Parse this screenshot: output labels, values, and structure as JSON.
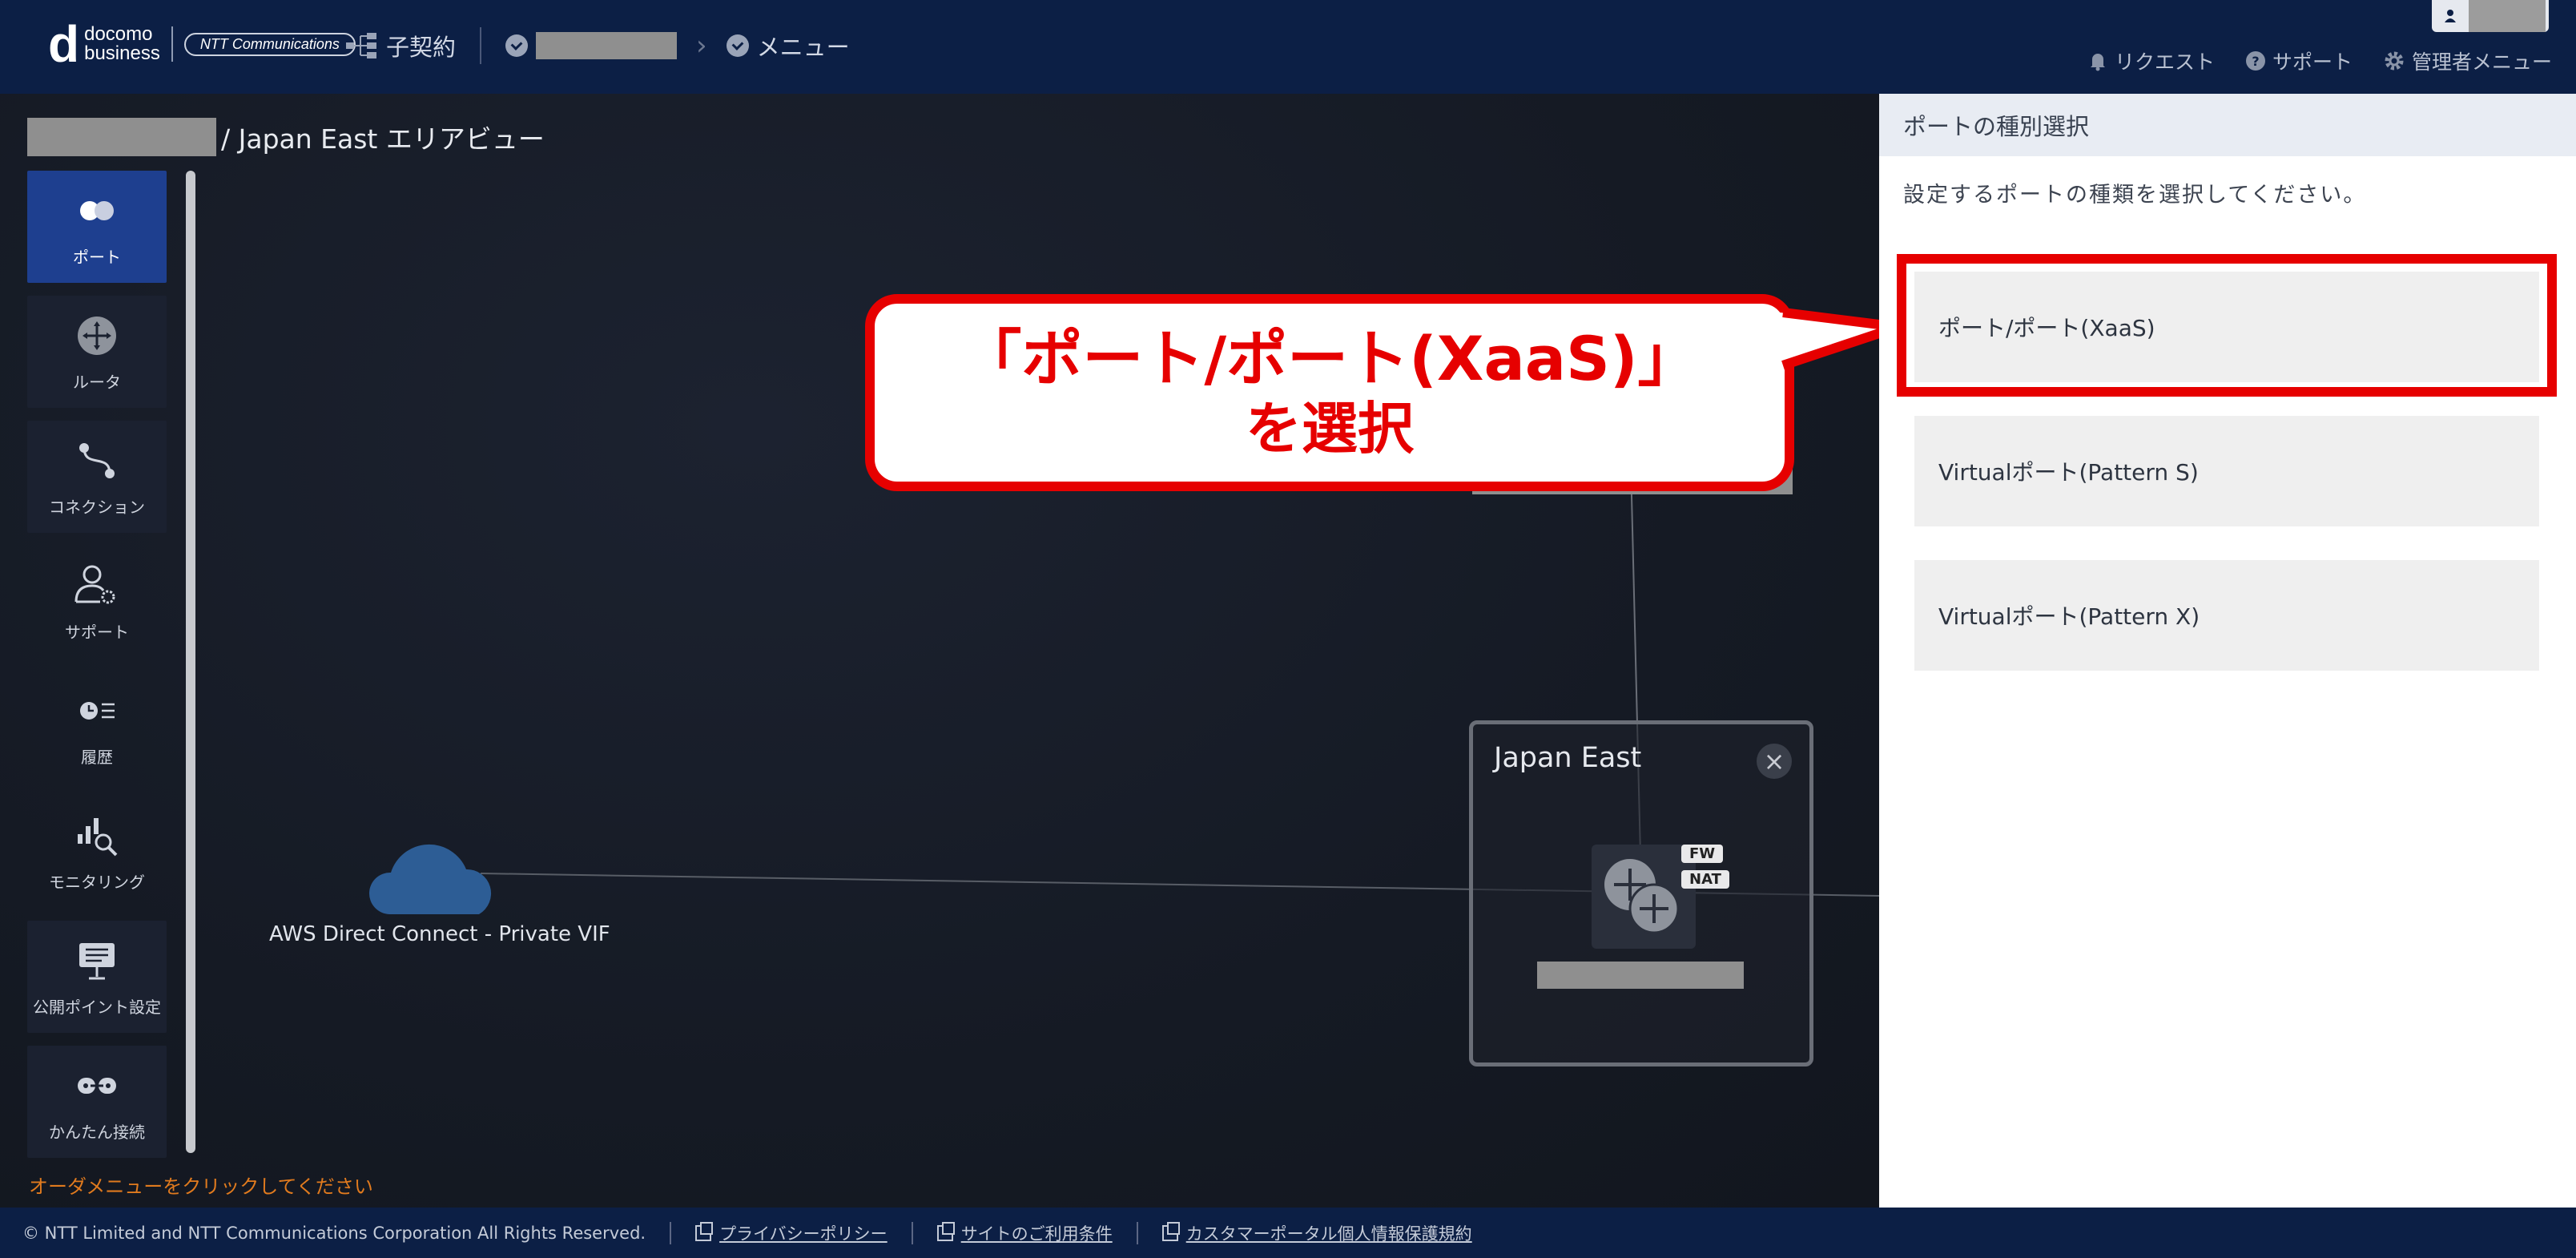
{
  "header": {
    "logo_line1": "docomo",
    "logo_line2": "business",
    "ntt_logo": "NTT Communications",
    "nav_contract": "子契約",
    "nav_menu": "メニュー",
    "links": [
      "リクエスト",
      "サポート",
      "管理者メニュー"
    ]
  },
  "breadcrumb": {
    "suffix": "/ Japan East エリアビュー"
  },
  "sidebar": {
    "items": [
      {
        "label": "ポート",
        "icon": "port-icon",
        "active": true
      },
      {
        "label": "ルータ",
        "icon": "router-icon"
      },
      {
        "label": "コネクション",
        "icon": "connection-icon"
      },
      {
        "label": "サポート",
        "icon": "support-icon"
      },
      {
        "label": "履歴",
        "icon": "history-icon"
      },
      {
        "label": "モニタリング",
        "icon": "monitoring-icon"
      },
      {
        "label": "公開ポイント設定",
        "icon": "public-point-icon"
      },
      {
        "label": "かんたん接続",
        "icon": "easy-connect-icon"
      }
    ],
    "order_message": "オーダメニューをクリックしてください"
  },
  "diagram": {
    "cloud_label": "AWS Direct Connect - Private VIF",
    "region_title": "Japan East",
    "tags": [
      "FW",
      "NAT"
    ]
  },
  "callout": {
    "line1": "「ポート/ポート(XaaS)」",
    "line2": "を選択"
  },
  "panel": {
    "title": "ポートの種別選択",
    "description": "設定するポートの種類を選択してください。",
    "options": [
      "ポート/ポート(XaaS)",
      "Virtualポート(Pattern S)",
      "Virtualポート(Pattern X)"
    ]
  },
  "footer": {
    "copyright": "© NTT Limited and NTT Communications Corporation All Rights Reserved.",
    "links": [
      "プライバシーポリシー",
      "サイトのご利用条件",
      "カスタマーポータル個人情報保護規約"
    ]
  },
  "colors": {
    "header_bg": "#0c1f45",
    "accent_red": "#e60000",
    "active_sidebar": "#1e3f8f",
    "order_msg": "#e07a1e"
  }
}
